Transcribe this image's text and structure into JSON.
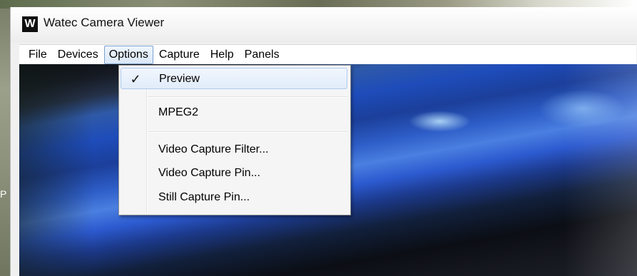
{
  "window": {
    "logo_letter": "W",
    "title": "Watec Camera Viewer"
  },
  "desktop": {
    "edge_label": "P"
  },
  "menubar": {
    "items": [
      {
        "label": "File"
      },
      {
        "label": "Devices"
      },
      {
        "label": "Options"
      },
      {
        "label": "Capture"
      },
      {
        "label": "Help"
      },
      {
        "label": "Panels"
      }
    ],
    "open_item": "Options"
  },
  "options_menu": {
    "check_icon": "✓",
    "items": [
      {
        "label": "Preview",
        "checked": true,
        "highlighted": true
      },
      {
        "label": "MPEG2",
        "checked": false
      },
      {
        "label": "Video Capture Filter...",
        "checked": false
      },
      {
        "label": "Video Capture Pin...",
        "checked": false
      },
      {
        "label": "Still Capture Pin...",
        "checked": false
      }
    ]
  },
  "colors": {
    "menu_highlight_border": "#aecbf0",
    "open_menu_border": "#7da2ce",
    "video_blue": "#2c5ad0"
  }
}
